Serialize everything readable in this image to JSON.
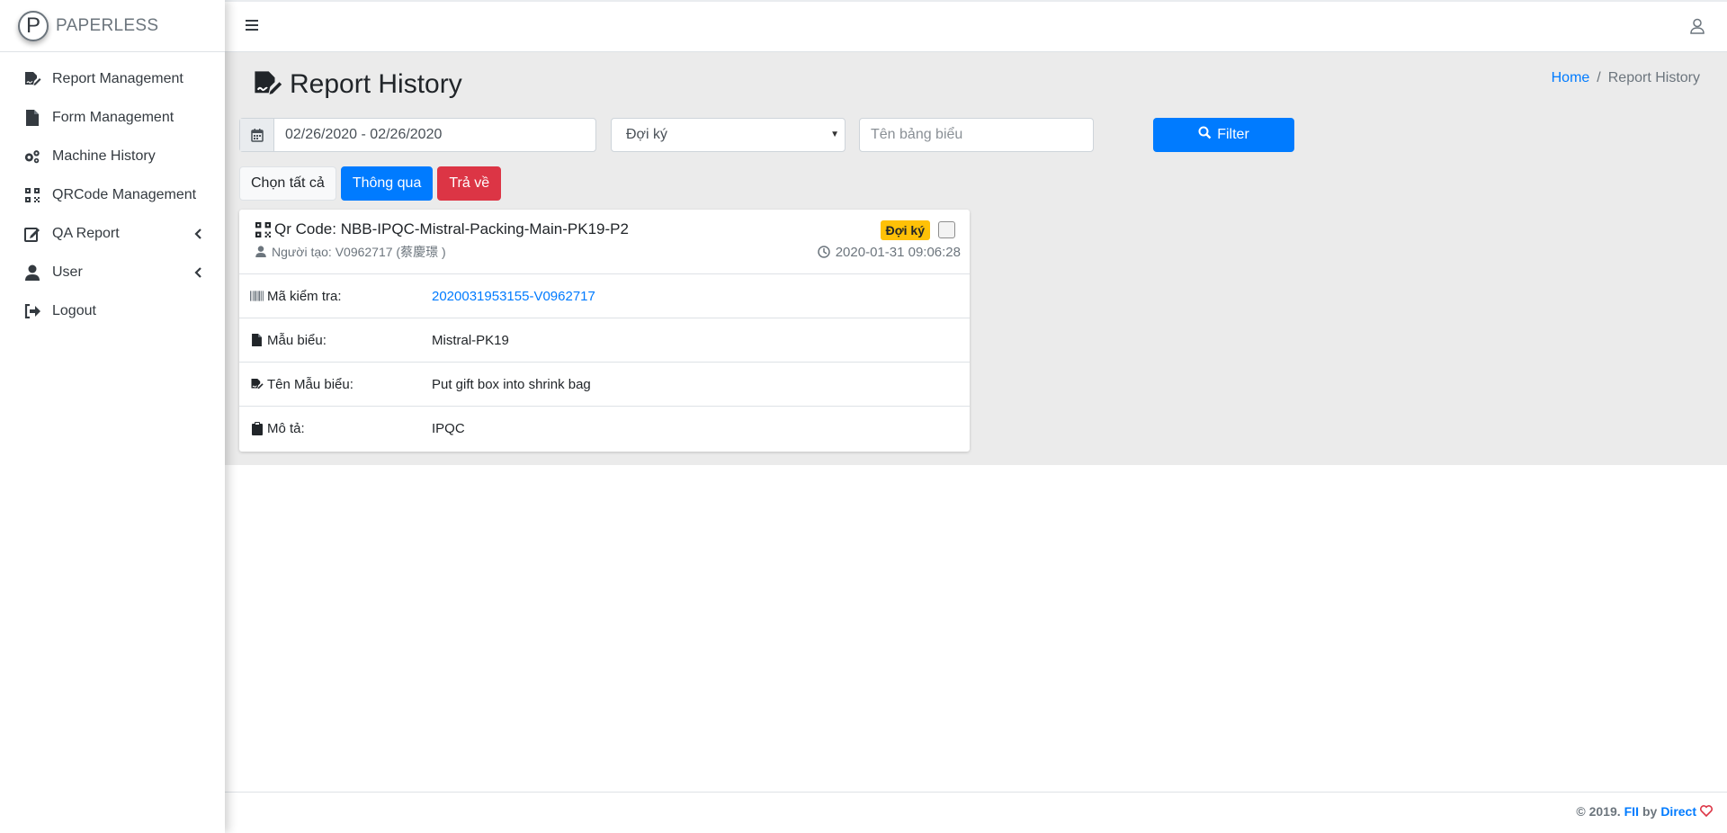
{
  "brand": {
    "logo_letter": "P",
    "name": "PAPERLESS"
  },
  "sidebar": {
    "items": [
      {
        "label": "Report Management",
        "icon": "file-signature-icon"
      },
      {
        "label": "Form Management",
        "icon": "file-icon"
      },
      {
        "label": "Machine History",
        "icon": "cogs-icon"
      },
      {
        "label": "QRCode Management",
        "icon": "qrcode-icon"
      },
      {
        "label": "QA Report",
        "icon": "edit-icon",
        "has_submenu": true
      },
      {
        "label": "User",
        "icon": "user-icon",
        "has_submenu": true
      },
      {
        "label": "Logout",
        "icon": "sign-out-icon"
      }
    ]
  },
  "page": {
    "title": "Report History",
    "breadcrumb": {
      "home": "Home",
      "separator": "/",
      "current": "Report History"
    }
  },
  "filters": {
    "date_range": "02/26/2020 - 02/26/2020",
    "status_selected": "Đợi ký",
    "form_name_placeholder": "Tên bảng biểu",
    "filter_label": "Filter"
  },
  "actions": {
    "select_all": "Chọn tất cả",
    "approve": "Thông qua",
    "return": "Trả về"
  },
  "report": {
    "qr_code_label": "Qr Code: NBB-IPQC-Mistral-Packing-Main-PK19-P2",
    "creator_label": "Người tạo: V0962717 (蔡慶璟 )",
    "status_badge": "Đợi ký",
    "timestamp": "2020-01-31 09:06:28",
    "details": [
      {
        "label": "Mã kiểm tra:",
        "value": "2020031953155-V0962717",
        "icon": "barcode-icon",
        "is_link": true
      },
      {
        "label": "Mẫu biểu:",
        "value": "Mistral-PK19",
        "icon": "file-icon",
        "is_link": false
      },
      {
        "label": "Tên Mẫu biểu:",
        "value": "Put gift box into shrink bag",
        "icon": "file-signature-icon",
        "is_link": false
      },
      {
        "label": "Mô tả:",
        "value": "IPQC",
        "icon": "clipboard-icon",
        "is_link": false
      }
    ]
  },
  "footer": {
    "copyright": "© 2019.",
    "org": "FII",
    "by": "by",
    "team": "Direct"
  },
  "colors": {
    "primary": "#007bff",
    "danger": "#dc3545",
    "warning": "#ffc107",
    "content_bg": "#ebebeb"
  }
}
